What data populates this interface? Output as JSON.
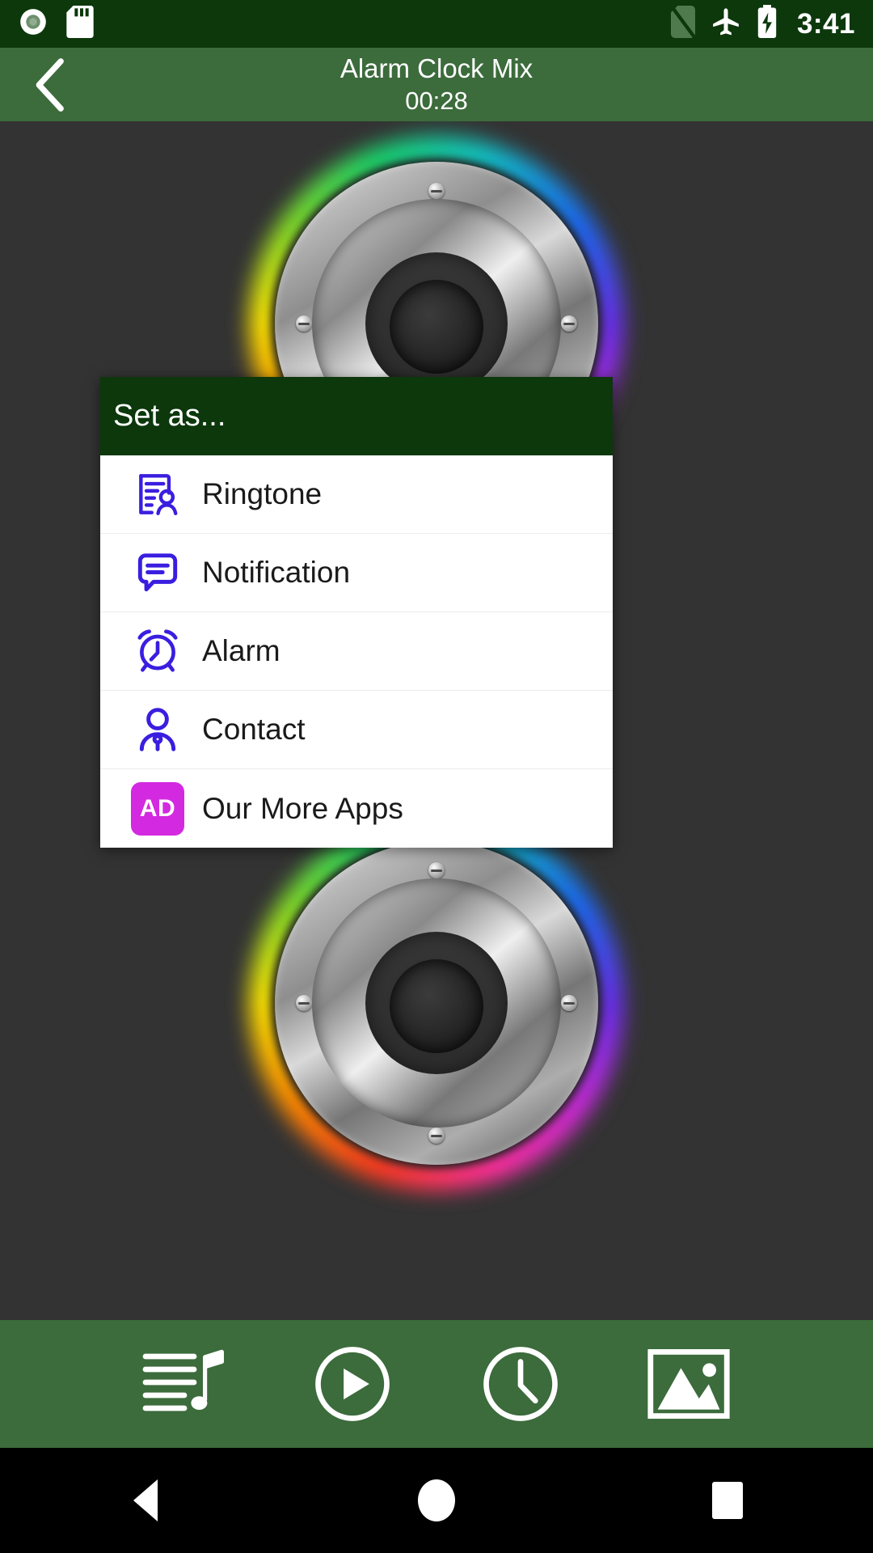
{
  "status_bar": {
    "icons_left": [
      "record-dot-icon",
      "sd-card-icon"
    ],
    "icons_right": [
      "no-sim-icon",
      "airplane-mode-icon",
      "battery-charging-icon"
    ],
    "time": "3:41"
  },
  "header": {
    "back_icon": "back-chevron-icon",
    "title": "Alarm Clock Mix",
    "duration": "00:28"
  },
  "artwork": {
    "name": "speaker-album-art",
    "description": "Rainbow-glow loudspeaker"
  },
  "dialog": {
    "title": "Set as...",
    "items": [
      {
        "label": "Ringtone",
        "icon": "ringtone-document-person-icon"
      },
      {
        "label": "Notification",
        "icon": "notification-speech-bubble-icon"
      },
      {
        "label": "Alarm",
        "icon": "alarm-clock-icon"
      },
      {
        "label": "Contact",
        "icon": "contact-person-icon"
      },
      {
        "label": "Our More Apps",
        "icon": "ad-badge-icon",
        "badge": "AD"
      }
    ]
  },
  "toolbar": {
    "items": [
      {
        "name": "playlist-music-icon"
      },
      {
        "name": "play-circle-icon"
      },
      {
        "name": "clock-icon"
      },
      {
        "name": "image-gallery-icon"
      }
    ]
  },
  "nav_bar": {
    "back": "nav-back-icon",
    "home": "nav-home-icon",
    "recents": "nav-recents-icon"
  },
  "colors": {
    "status_bar": "#0c380c",
    "app_bar": "#3c6b3c",
    "background": "#333333",
    "dialog_header": "#0c380c",
    "dialog_body": "#ffffff",
    "icon_accent": "#3a1ee0",
    "ad_badge": "#d329e0"
  }
}
